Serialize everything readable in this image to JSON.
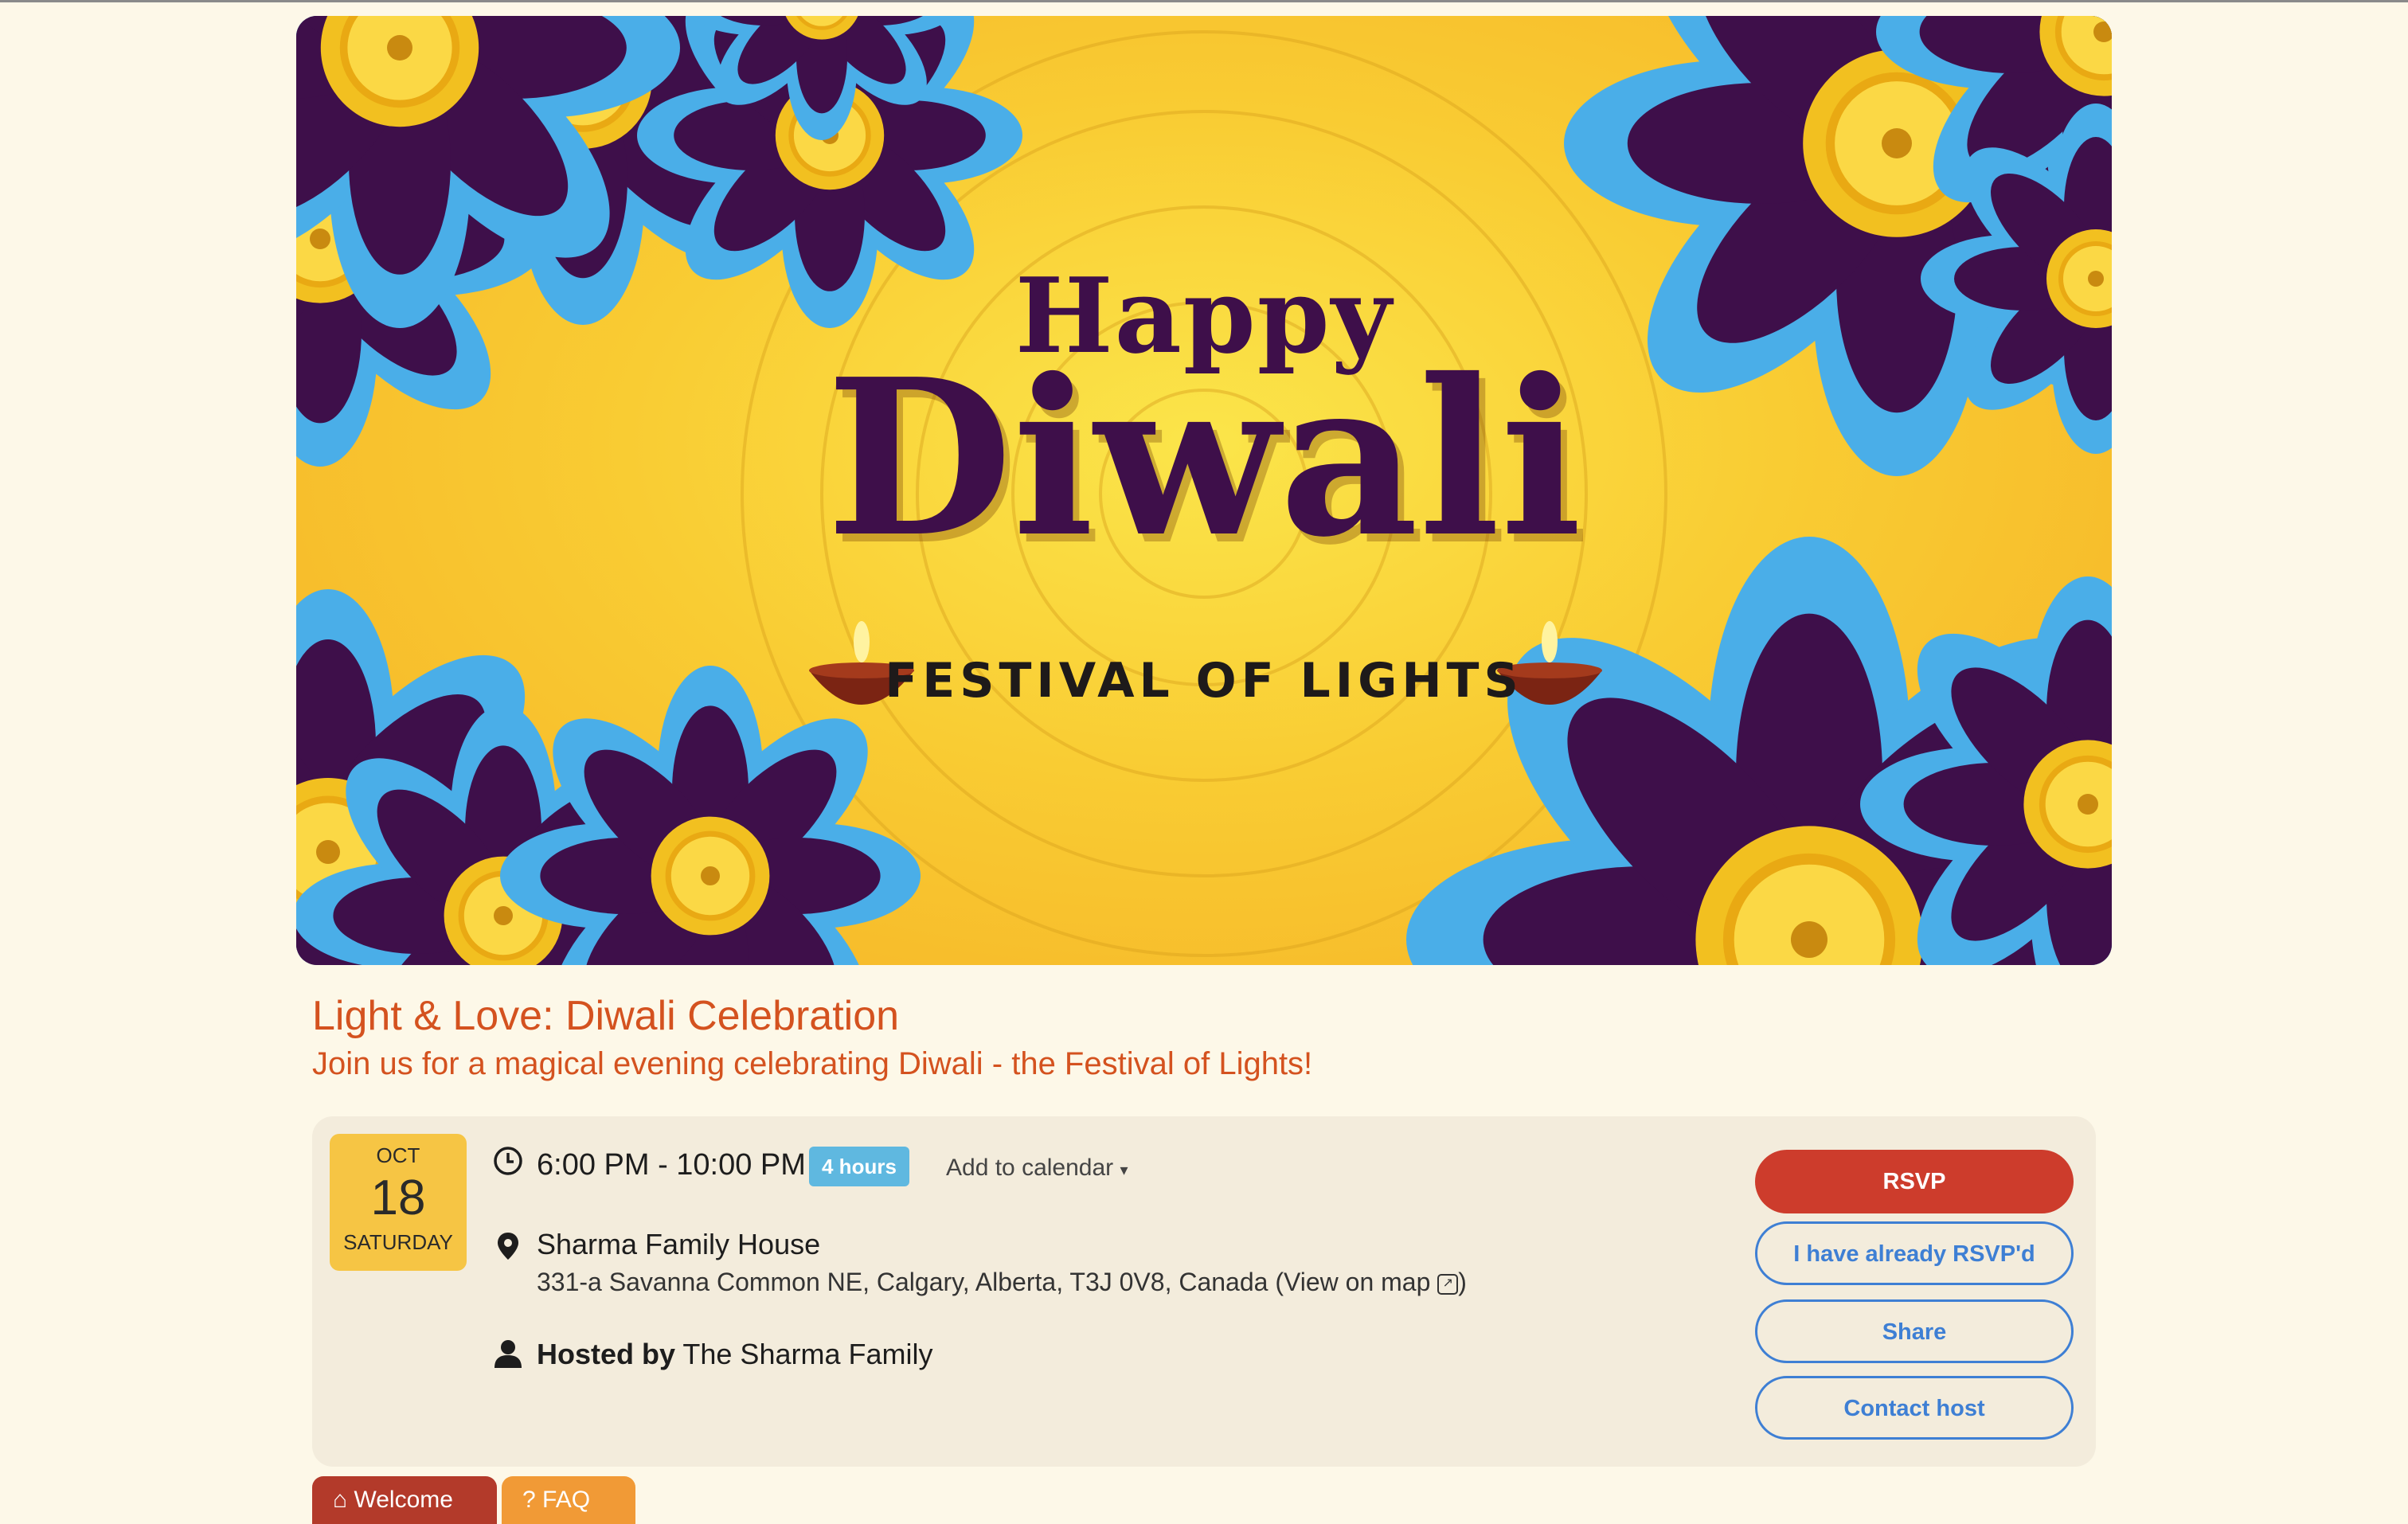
{
  "banner": {
    "line1": "Happy",
    "line2": "Diwali",
    "line3": "FESTIVAL OF LIGHTS"
  },
  "event": {
    "title": "Light & Love: Diwali Celebration",
    "subtitle": "Join us for a magical evening celebrating Diwali - the Festival of Lights!"
  },
  "date": {
    "month": "OCT",
    "day": "18",
    "weekday": "SATURDAY"
  },
  "time": {
    "range": "6:00 PM - 10:00 PM",
    "duration": "4 hours",
    "calendar_label": "Add to calendar"
  },
  "venue": {
    "name": "Sharma Family House",
    "address": "331-a Savanna Common NE, Calgary, Alberta, T3J 0V8, Canada (View on map"
  },
  "host": {
    "prefix": "Hosted by",
    "name": "The Sharma Family"
  },
  "actions": {
    "rsvp": "RSVP",
    "already": "I have already RSVP'd",
    "share": "Share",
    "contact": "Contact host"
  },
  "tabs": [
    {
      "label": "Welcome"
    },
    {
      "label": "FAQ"
    }
  ],
  "colors": {
    "accent": "#d4521f",
    "rsvp": "#cd3c2c",
    "outline": "#3e7fd4",
    "date_box": "#f6c544",
    "badge": "#5fb8e0"
  },
  "icons": [
    "clock-icon",
    "location-pin-icon",
    "person-icon",
    "caret-down-icon",
    "external-link-icon",
    "home-icon",
    "question-icon"
  ]
}
